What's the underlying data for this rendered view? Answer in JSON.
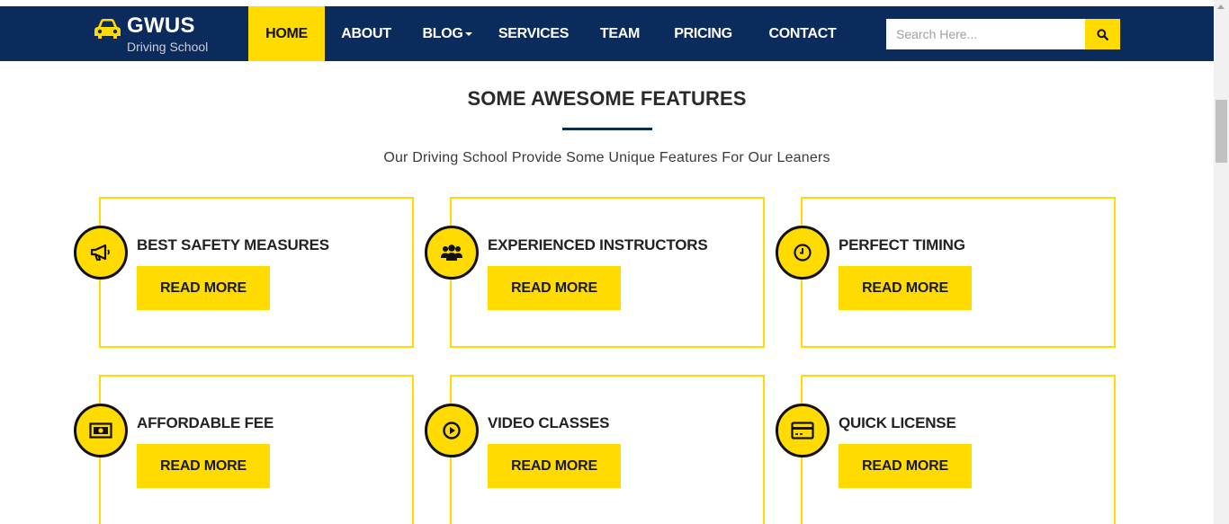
{
  "header": {
    "logo": {
      "title": "GWUS",
      "subtitle": "Driving School"
    },
    "nav": [
      {
        "label": "HOME",
        "active": true
      },
      {
        "label": "ABOUT",
        "active": false
      },
      {
        "label": "BLOG",
        "active": false,
        "dropdown": true
      },
      {
        "label": "SERVICES",
        "active": false
      },
      {
        "label": "TEAM",
        "active": false
      },
      {
        "label": "PRICING",
        "active": false
      },
      {
        "label": "CONTACT",
        "active": false
      }
    ],
    "search": {
      "placeholder": "Search Here...",
      "value": "",
      "icon": "search-icon"
    }
  },
  "features": {
    "title": "SOME AWESOME FEATURES",
    "subtitle": "Our Driving School Provide Some Unique Features For Our Leaners",
    "cards": [
      {
        "title": "BEST SAFETY MEASURES",
        "button": "READ MORE",
        "icon": "megaphone-icon"
      },
      {
        "title": "EXPERIENCED INSTRUCTORS",
        "button": "READ MORE",
        "icon": "users-icon"
      },
      {
        "title": "PERFECT TIMING",
        "button": "READ MORE",
        "icon": "clock-icon"
      },
      {
        "title": "AFFORDABLE FEE",
        "button": "READ MORE",
        "icon": "money-icon"
      },
      {
        "title": "VIDEO CLASSES",
        "button": "READ MORE",
        "icon": "play-icon"
      },
      {
        "title": "QUICK LICENSE",
        "button": "READ MORE",
        "icon": "credit-card-icon"
      }
    ]
  },
  "colors": {
    "navbar": "#0c2b5d",
    "accent": "#ffdb00",
    "text": "#2b2b2b"
  }
}
